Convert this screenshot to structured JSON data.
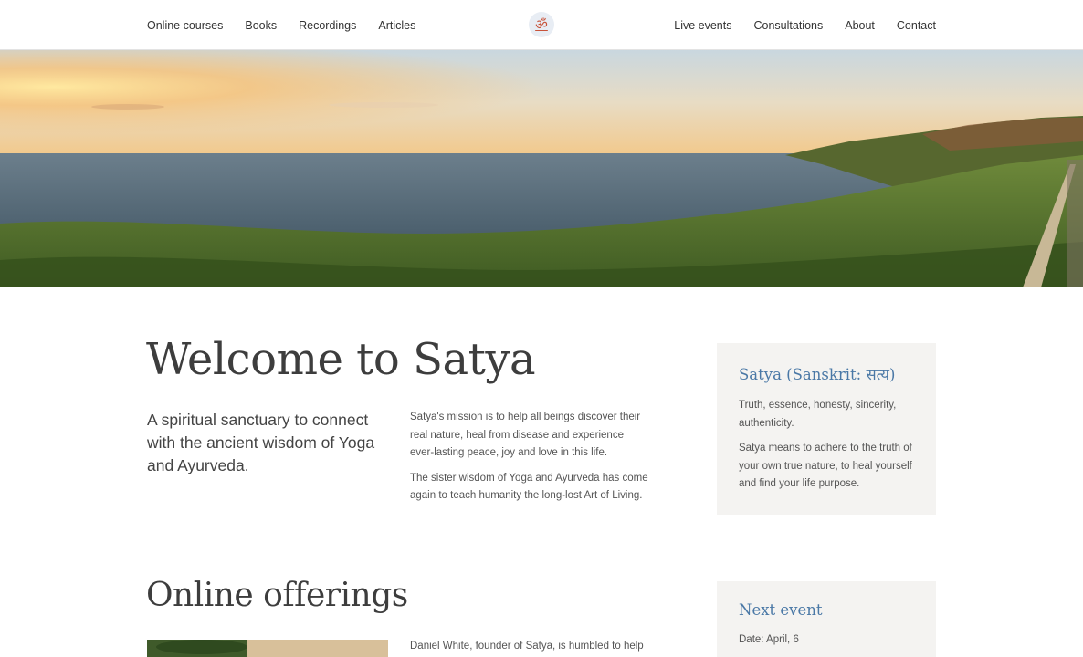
{
  "nav": {
    "left": [
      "Online courses",
      "Books",
      "Recordings",
      "Articles"
    ],
    "right": [
      "Live events",
      "Consultations",
      "About",
      "Contact"
    ],
    "logo_glyph": "ॐ"
  },
  "hero": {
    "image": "sunset-ocean-coastline"
  },
  "welcome": {
    "title": "Welcome to Satya",
    "tagline": "A spiritual sanctuary to connect with the ancient wisdom of Yoga and Ayurveda.",
    "mission_p1": "Satya's mission is to help all beings discover their real nature, heal from disease and experience ever-lasting peace, joy and love in this life.",
    "mission_p2": "The sister wisdom of Yoga and Ayurveda has come again to teach humanity the long-lost Art of Living."
  },
  "satya_card": {
    "title": "Satya (Sanskrit: सत्य)",
    "p1": "Truth, essence, honesty, sincerity, authenticity.",
    "p2": "Satya means to adhere to the truth of your own true nature, to heal yourself and find your life purpose."
  },
  "offerings": {
    "title": "Online offerings",
    "text": "Daniel White, founder of Satya, is humbled to help"
  },
  "event_card": {
    "title": "Next event",
    "date": "Date: April, 6"
  },
  "colors": {
    "accent": "#4a78a6",
    "card_bg": "#f4f3f1",
    "logo": "#c8533a"
  }
}
